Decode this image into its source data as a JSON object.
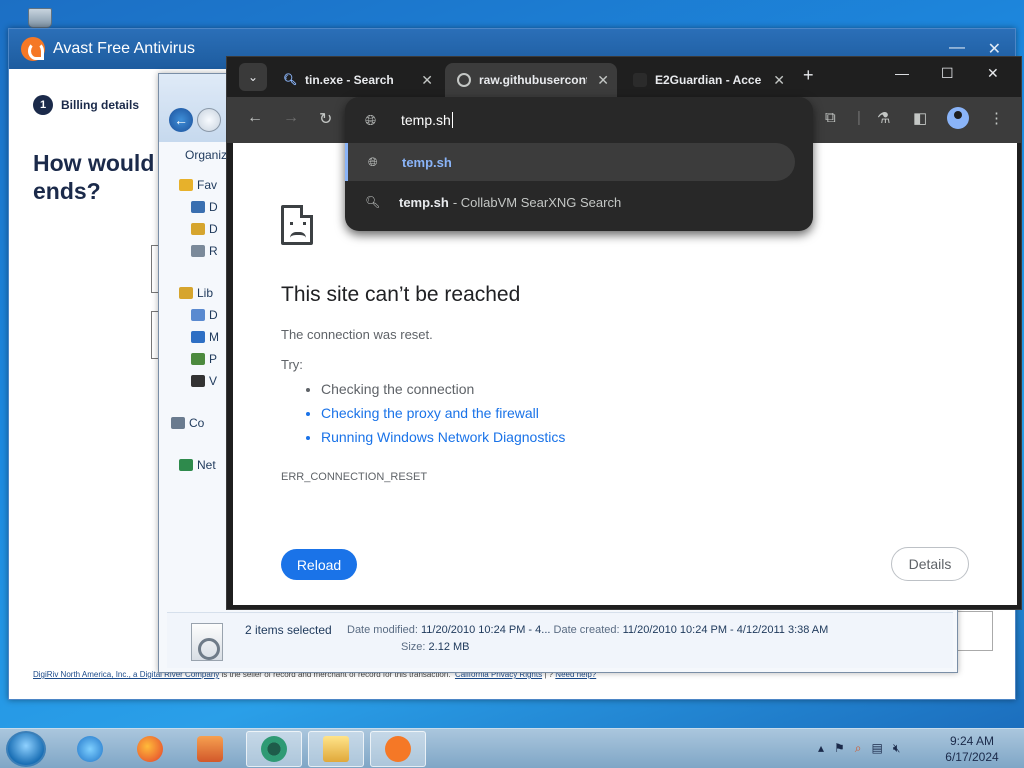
{
  "avast": {
    "title": "Avast Free Antivirus",
    "step_number": "1",
    "step_label": "Billing details",
    "question": "How would ends?",
    "footer_seller": "DigiRiv North America, Inc., a Digital River Company",
    "footer_text": " is the seller of record and merchant of record for this transaction.",
    "footer_privacy": "California Privacy Rights",
    "footer_help": "Need help?"
  },
  "explorer": {
    "organize": "Organiz",
    "tree": [
      {
        "label": "Fav",
        "icon": "star-icon"
      },
      {
        "label": "D",
        "icon": "desktop-icon"
      },
      {
        "label": "D",
        "icon": "downloads-icon"
      },
      {
        "label": "R",
        "icon": "recent-places-icon"
      },
      {
        "label": "Lib",
        "icon": "libraries-icon"
      },
      {
        "label": "D",
        "icon": "documents-icon"
      },
      {
        "label": "M",
        "icon": "music-icon"
      },
      {
        "label": "P",
        "icon": "pictures-icon"
      },
      {
        "label": "V",
        "icon": "videos-icon"
      },
      {
        "label": "Co",
        "icon": "computer-icon"
      },
      {
        "label": "Net",
        "icon": "network-icon"
      }
    ],
    "status": {
      "selected": "2 items selected",
      "modified_label": "Date modified:",
      "modified_value": "11/20/2010 10:24 PM - 4...",
      "created_label": "Date created:",
      "created_value": "11/20/2010 10:24 PM - 4/12/2011 3:38 AM",
      "size_label": "Size:",
      "size_value": "2.12 MB"
    }
  },
  "chrome": {
    "tabs": [
      {
        "title": "tin.exe - Search",
        "icon": "search-icon"
      },
      {
        "title": "raw.githubuserconte",
        "icon": "globe-icon"
      },
      {
        "title": "E2Guardian - Acce",
        "icon": "page-icon"
      }
    ],
    "omnibox_text": "temp.sh",
    "suggestions": [
      {
        "query": "temp.sh",
        "rest": ""
      },
      {
        "query": "temp.sh",
        "rest": "- CollabVM SearXNG Search"
      }
    ],
    "error": {
      "title": "This site can’t be reached",
      "message": "The connection was reset.",
      "try": "Try:",
      "items": [
        "Checking the connection",
        "Checking the proxy and the firewall",
        "Running Windows Network Diagnostics"
      ],
      "code": "ERR_CONNECTION_RESET",
      "reload": "Reload",
      "details": "Details"
    }
  },
  "taskbar": {
    "time": "9:24 AM",
    "date": "6/17/2024"
  }
}
